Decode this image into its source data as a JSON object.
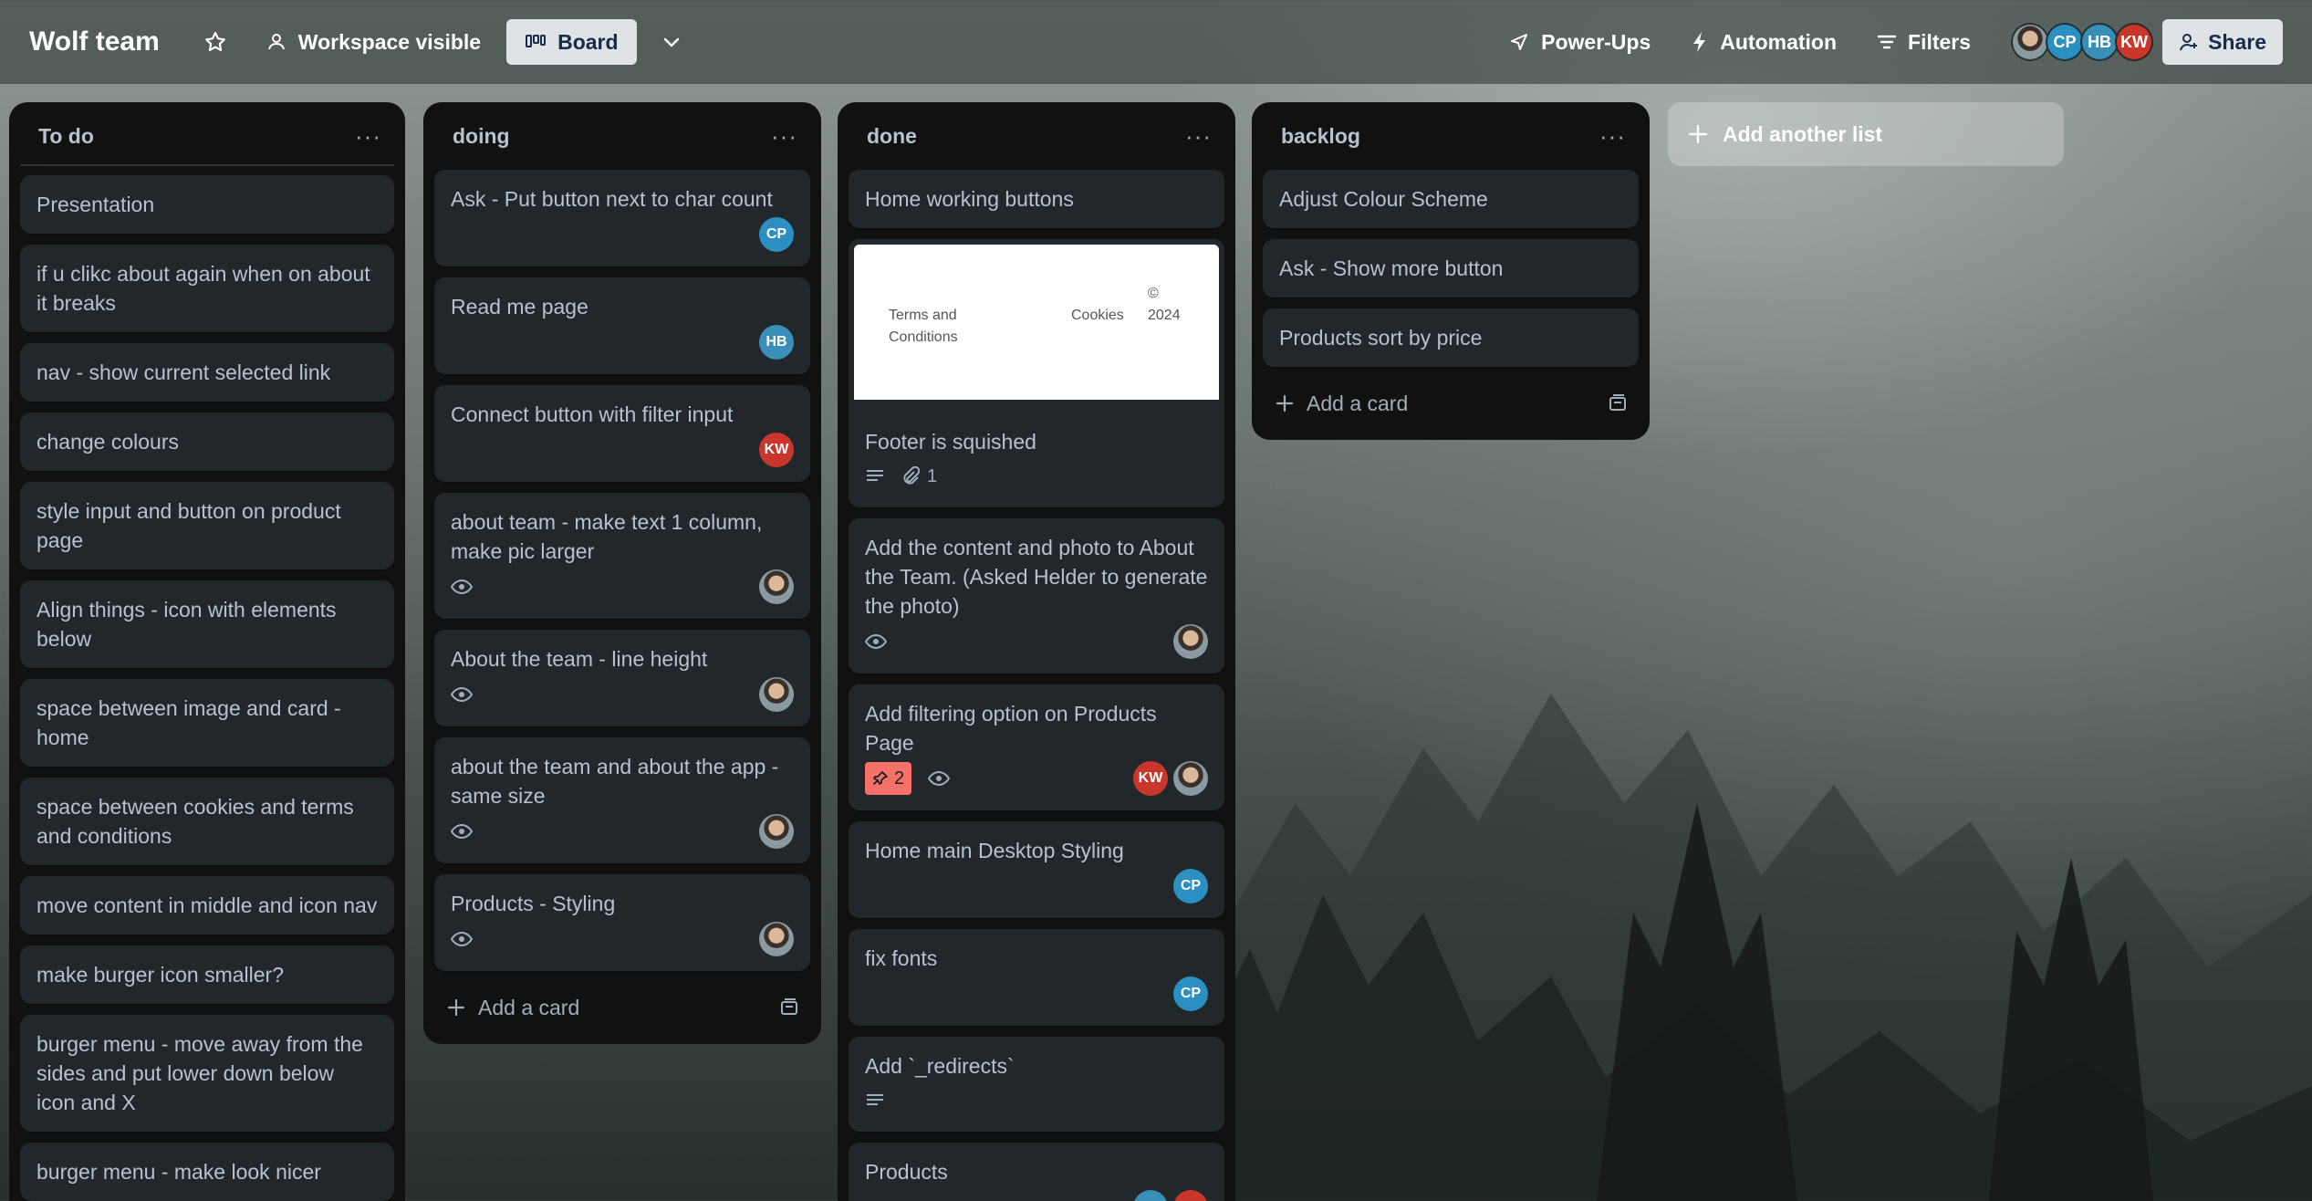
{
  "header": {
    "board_title": "Wolf team",
    "visibility_label": "Workspace visible",
    "view_label": "Board",
    "powerups_label": "Power-Ups",
    "automation_label": "Automation",
    "filters_label": "Filters",
    "share_label": "Share",
    "members": [
      "photo",
      "CP",
      "HB",
      "KW"
    ]
  },
  "lists": [
    {
      "title": "To do",
      "cards": [
        {
          "title": "Presentation"
        },
        {
          "title": "if u clikc about again when on about it breaks"
        },
        {
          "title": "nav - show current selected link"
        },
        {
          "title": "change colours"
        },
        {
          "title": "style input and button on product page"
        },
        {
          "title": "Align things - icon with elements below"
        },
        {
          "title": "space between image and card - home"
        },
        {
          "title": "space between cookies and terms and conditions"
        },
        {
          "title": "move content in middle and icon nav"
        },
        {
          "title": "make burger icon smaller?"
        },
        {
          "title": "burger menu - move away from the sides and put lower down below icon and X"
        },
        {
          "title": "burger menu - make look nicer"
        }
      ]
    },
    {
      "title": "doing",
      "add_card_label": "Add a card",
      "cards": [
        {
          "title": "Ask - Put button next to char count",
          "members": [
            "CP"
          ]
        },
        {
          "title": "Read me page",
          "members": [
            "HB"
          ]
        },
        {
          "title": "Connect button with filter input",
          "members": [
            "KW"
          ]
        },
        {
          "title": "about team - make text 1 column, make pic larger",
          "watch": true,
          "members": [
            "photo"
          ]
        },
        {
          "title": "About the team - line height",
          "watch": true,
          "members": [
            "photo"
          ]
        },
        {
          "title": "about the team and about the app - same size",
          "watch": true,
          "members": [
            "photo"
          ]
        },
        {
          "title": "Products - Styling",
          "watch": true,
          "members": [
            "photo"
          ]
        }
      ]
    },
    {
      "title": "done",
      "cards": [
        {
          "title": "Home working buttons"
        },
        {
          "title": "Footer is squished",
          "cover": {
            "left": "Terms and Conditions",
            "middle": "Cookies",
            "copyright": "©",
            "year": "2024"
          },
          "description": true,
          "attachments": "1"
        },
        {
          "title": "Add the content and photo to About the Team. (Asked Helder to generate the photo)",
          "watch": true,
          "members": [
            "photo"
          ]
        },
        {
          "title": "Add filtering option on Products Page",
          "votes": "2",
          "watch": true,
          "members": [
            "KW",
            "photo"
          ]
        },
        {
          "title": "Home main Desktop Styling",
          "members": [
            "CP"
          ]
        },
        {
          "title": "fix fonts",
          "members": [
            "CP"
          ]
        },
        {
          "title": "Add `_redirects`",
          "description": true
        },
        {
          "title": "Products",
          "members": [
            "HB",
            "KW"
          ]
        }
      ]
    },
    {
      "title": "backlog",
      "add_card_label": "Add a card",
      "cards": [
        {
          "title": "Adjust Colour Scheme"
        },
        {
          "title": "Ask - Show more button"
        },
        {
          "title": "Products sort by price"
        }
      ]
    }
  ],
  "add_list_label": "Add another list",
  "colors": {
    "list_bg": "#111210",
    "card_bg": "#22272b",
    "text": "#b6c2cf",
    "cp": "#2b8fc2",
    "kw": "#c9372c",
    "vote": "#f87168"
  }
}
